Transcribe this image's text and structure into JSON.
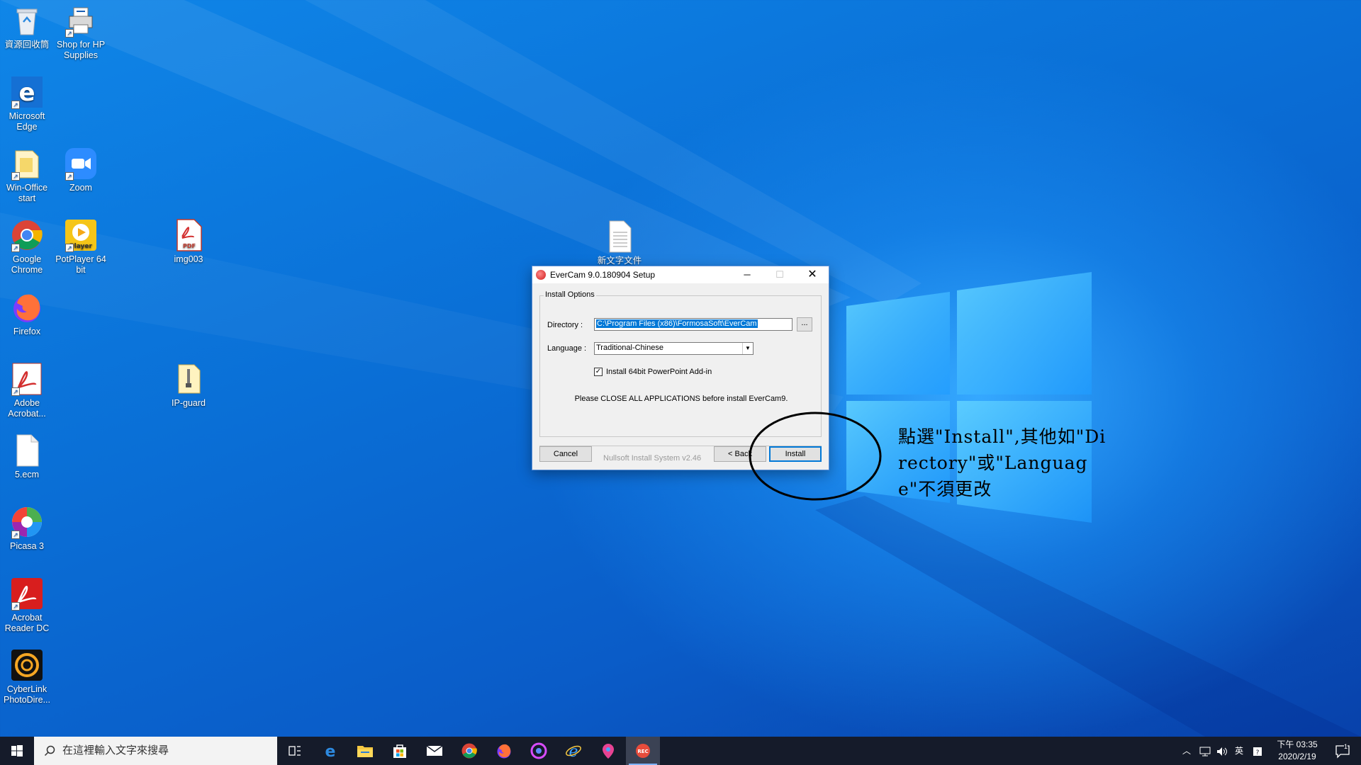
{
  "desktop": {
    "icons": [
      {
        "label": "資源回收筒"
      },
      {
        "label": "Shop for HP Supplies"
      },
      {
        "label": "Microsoft Edge"
      },
      {
        "label": "Win-Office start"
      },
      {
        "label": "Zoom"
      },
      {
        "label": "Google Chrome"
      },
      {
        "label": "PotPlayer 64 bit"
      },
      {
        "label": "img003"
      },
      {
        "label": "Firefox"
      },
      {
        "label": "Adobe Acrobat..."
      },
      {
        "label": "IP-guard"
      },
      {
        "label": "5.ecm"
      },
      {
        "label": "Picasa 3"
      },
      {
        "label": "Acrobat Reader DC"
      },
      {
        "label": "CyberLink PhotoDire..."
      },
      {
        "label": "新文字文件"
      }
    ]
  },
  "dialog": {
    "title": "EverCam 9.0.180904 Setup",
    "group_label": "Install Options",
    "directory_label": "Directory :",
    "directory_value": "C:\\Program Files (x86)\\FormosaSoft\\EverCam",
    "browse_label": "...",
    "language_label": "Language :",
    "language_value": "Traditional-Chinese",
    "checkbox_label": "Install 64bit PowerPoint Add-in",
    "checkbox_checked": true,
    "notice": "Please CLOSE ALL APPLICATIONS before install EverCam9.",
    "nsis_label": "Nullsoft Install System v2.46",
    "cancel_label": "Cancel",
    "back_label": "< Back",
    "install_label": "Install"
  },
  "annotation": {
    "text": "點選\"Install\",其他如\"Directory\"或\"Language\"不須更改"
  },
  "taskbar": {
    "search_placeholder": "在這裡輸入文字來搜尋",
    "apps": [
      "task-view",
      "edge",
      "file-explorer",
      "store",
      "mail",
      "chrome",
      "firefox",
      "app-circle",
      "ie",
      "maps",
      "evercam"
    ],
    "tray_ime": "英",
    "clock_time": "下午 03:35",
    "clock_date": "2020/2/19",
    "notification_count": "1"
  }
}
